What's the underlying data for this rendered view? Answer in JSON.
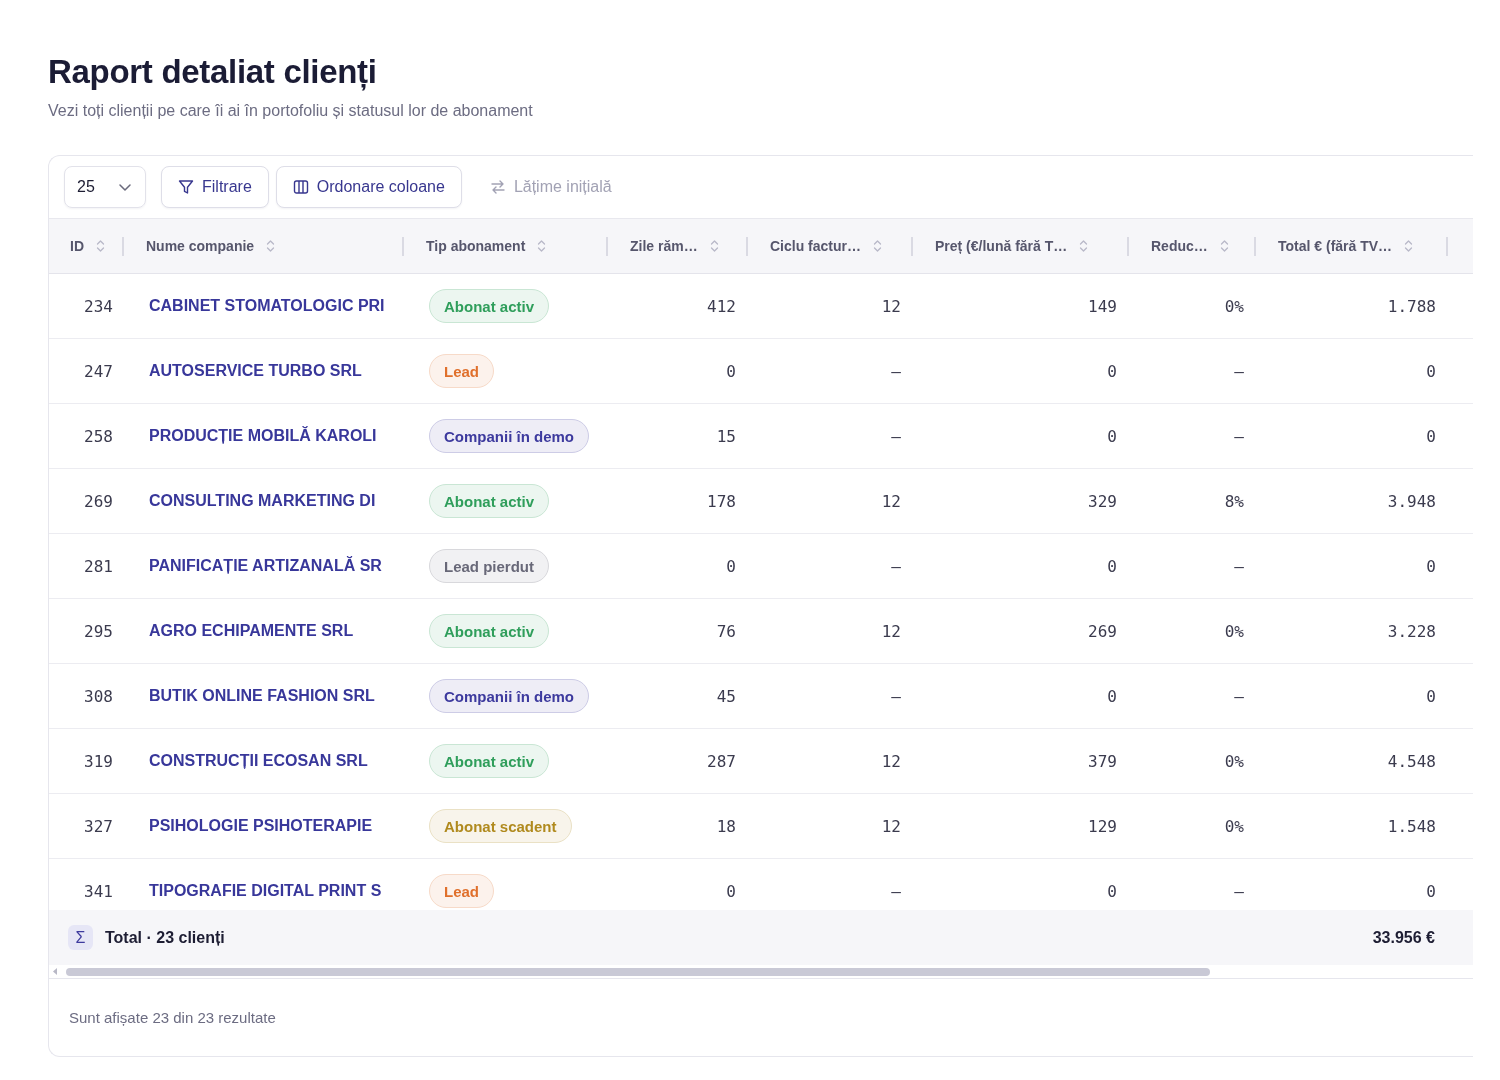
{
  "header": {
    "title": "Raport detaliat clienți",
    "subtitle": "Vezi toți clienții pe care îi ai în portofoliu și statusul lor de abonament"
  },
  "toolbar": {
    "page_size": "25",
    "buttons": [
      {
        "label": "Filtrare",
        "kind": "filter",
        "disabled": false
      },
      {
        "label": "Ordonare coloane",
        "kind": "columns",
        "disabled": false
      },
      {
        "label": "Lățime inițială",
        "kind": "reset",
        "disabled": true
      }
    ]
  },
  "table": {
    "columns": [
      "ID",
      "Nume companie",
      "Tip abonament",
      "Zile răm…",
      "Ciclu factur…",
      "Preț (€/lună fără T…",
      "Reduc…",
      "Total € (fără TV…"
    ],
    "rows": [
      {
        "id": "234",
        "company": "CABINET STOMATOLOGIC PRI",
        "status": {
          "label": "Abonat activ",
          "color": "#2f9e5b"
        },
        "days_left": "412",
        "billing_cycle": "12",
        "price": "149",
        "discount": "0%",
        "total": "1.788"
      },
      {
        "id": "247",
        "company": "AUTOSERVICE TURBO SRL",
        "status": {
          "label": "Lead",
          "color": "#e0702c"
        },
        "days_left": "0",
        "billing_cycle": "–",
        "price": "0",
        "discount": "–",
        "total": "0"
      },
      {
        "id": "258",
        "company": "PRODUCȚIE MOBILĂ KAROLI",
        "status": {
          "label": "Companii în demo",
          "color": "#3d3a9e"
        },
        "days_left": "15",
        "billing_cycle": "–",
        "price": "0",
        "discount": "–",
        "total": "0"
      },
      {
        "id": "269",
        "company": "CONSULTING MARKETING DI",
        "status": {
          "label": "Abonat activ",
          "color": "#2f9e5b"
        },
        "days_left": "178",
        "billing_cycle": "12",
        "price": "329",
        "discount": "8%",
        "total": "3.948"
      },
      {
        "id": "281",
        "company": "PANIFICAȚIE ARTIZANALĂ SR",
        "status": {
          "label": "Lead pierdut",
          "color": "#686878"
        },
        "days_left": "0",
        "billing_cycle": "–",
        "price": "0",
        "discount": "–",
        "total": "0"
      },
      {
        "id": "295",
        "company": "AGRO ECHIPAMENTE SRL",
        "status": {
          "label": "Abonat activ",
          "color": "#2f9e5b"
        },
        "days_left": "76",
        "billing_cycle": "12",
        "price": "269",
        "discount": "0%",
        "total": "3.228"
      },
      {
        "id": "308",
        "company": "BUTIK ONLINE FASHION SRL",
        "status": {
          "label": "Companii în demo",
          "color": "#3d3a9e"
        },
        "days_left": "45",
        "billing_cycle": "–",
        "price": "0",
        "discount": "–",
        "total": "0"
      },
      {
        "id": "319",
        "company": "CONSTRUCȚII ECOSAN SRL",
        "status": {
          "label": "Abonat activ",
          "color": "#2f9e5b"
        },
        "days_left": "287",
        "billing_cycle": "12",
        "price": "379",
        "discount": "0%",
        "total": "4.548"
      },
      {
        "id": "327",
        "company": "PSIHOLOGIE PSIHOTERAPIE",
        "status": {
          "label": "Abonat scadent",
          "color": "#b08a1e"
        },
        "days_left": "18",
        "billing_cycle": "12",
        "price": "129",
        "discount": "0%",
        "total": "1.548"
      },
      {
        "id": "341",
        "company": "TIPOGRAFIE DIGITAL PRINT S",
        "status": {
          "label": "Lead",
          "color": "#e0702c"
        },
        "days_left": "0",
        "billing_cycle": "–",
        "price": "0",
        "discount": "–",
        "total": "0"
      }
    ],
    "total": {
      "icon": "Σ",
      "label": "Total · 23 clienți",
      "amount": "33.956 €"
    }
  },
  "footer": {
    "text": "Sunt afișate 23 din 23 rezultate"
  }
}
